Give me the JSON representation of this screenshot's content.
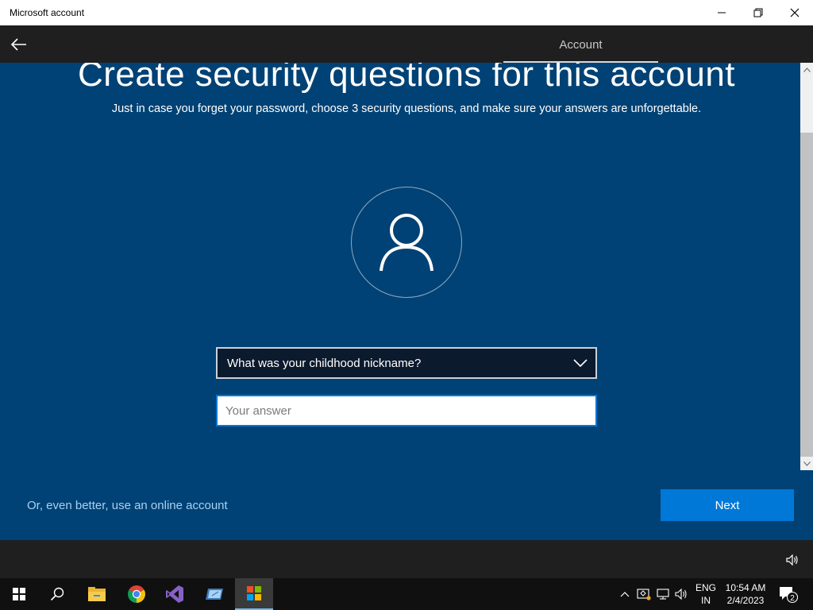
{
  "window": {
    "title": "Microsoft account",
    "minimize_icon": "minimize-icon",
    "maximize_icon": "restore-icon",
    "close_icon": "close-icon"
  },
  "header": {
    "back_icon": "back-arrow-icon",
    "title": "Account"
  },
  "main": {
    "heading": "Create security questions for this account",
    "subheading": "Just in case you forget your password, choose 3 security questions, and make sure your answers are unforgettable.",
    "avatar_icon": "user-icon",
    "question_select": {
      "selected": "What was your childhood nickname?"
    },
    "answer_input": {
      "value": "",
      "placeholder": "Your answer"
    },
    "online_account_link": "Or, even better, use an online account",
    "next_button": "Next"
  },
  "bottom_bar": {
    "volume_icon": "volume-icon"
  },
  "taskbar": {
    "items": [
      "start-icon",
      "search-icon",
      "file-explorer-icon",
      "chrome-icon",
      "visual-studio-icon",
      "app-icon",
      "microsoft-store-icon"
    ],
    "language": {
      "line1": "ENG",
      "line2": "IN"
    },
    "clock": {
      "time": "10:54 AM",
      "date": "2/4/2023"
    },
    "notification_count": "2"
  },
  "colors": {
    "main_bg": "#004275",
    "accent": "#0078d7",
    "header_bg": "#1f1f1f",
    "link": "#a8d0f5"
  }
}
